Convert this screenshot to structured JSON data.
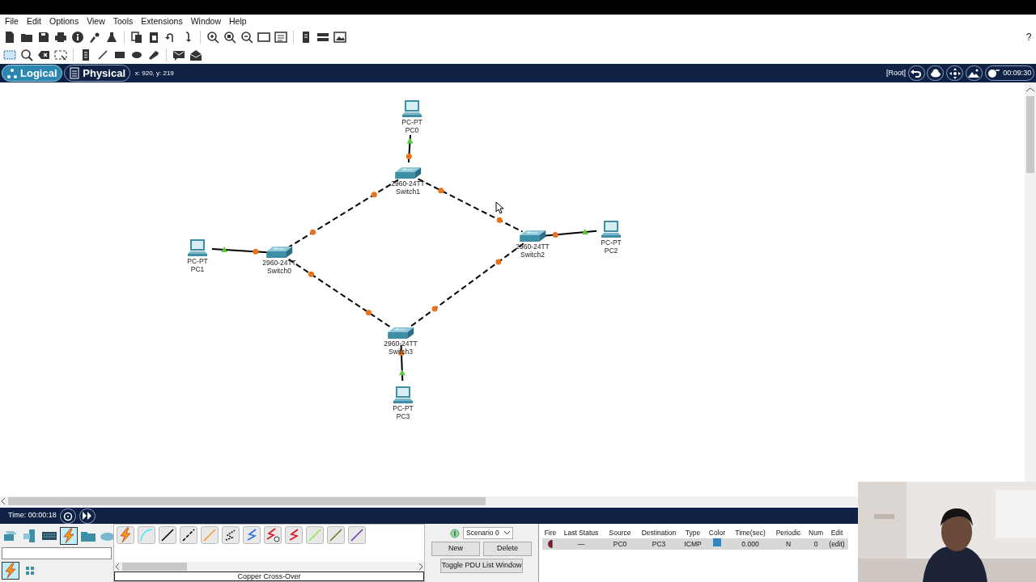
{
  "menu": [
    "File",
    "Edit",
    "Options",
    "View",
    "Tools",
    "Extensions",
    "Window",
    "Help"
  ],
  "help_button": "?",
  "workspace_tabs": [
    {
      "label": "Logical",
      "selected": true
    },
    {
      "label": "Physical",
      "selected": false
    }
  ],
  "cursor_position": "x: 920, y: 219",
  "root_label": "[Root]",
  "clock": "00:09:30",
  "devices": [
    {
      "kind": "pc",
      "model": "PC-PT",
      "name": "PC0"
    },
    {
      "kind": "switch",
      "model": "2960-24TT",
      "name": "Switch1"
    },
    {
      "kind": "switch",
      "model": "2960-24TT",
      "name": "Switch0"
    },
    {
      "kind": "switch",
      "model": "2960-24TT",
      "name": "Switch2"
    },
    {
      "kind": "pc",
      "model": "PC-PT",
      "name": "PC2"
    },
    {
      "kind": "pc",
      "model": "PC-PT",
      "name": "PC1"
    },
    {
      "kind": "switch",
      "model": "2960-24TT",
      "name": "Switch3"
    },
    {
      "kind": "pc",
      "model": "PC-PT",
      "name": "PC3"
    }
  ],
  "links": [
    {
      "kind": "straight",
      "ends": [
        {
          "kind": "triangle",
          "color": "#5cc93b"
        },
        {
          "kind": "circle",
          "color": "#e8731c"
        }
      ]
    },
    {
      "kind": "crossover",
      "ends": [
        {
          "kind": "circle",
          "color": "#e8731c"
        },
        {
          "kind": "circle",
          "color": "#e8731c"
        }
      ]
    },
    {
      "kind": "crossover",
      "ends": [
        {
          "kind": "circle",
          "color": "#e8731c"
        },
        {
          "kind": "circle",
          "color": "#e8731c"
        }
      ]
    },
    {
      "kind": "crossover",
      "ends": [
        {
          "kind": "circle",
          "color": "#e8731c"
        },
        {
          "kind": "circle",
          "color": "#e8731c"
        }
      ]
    },
    {
      "kind": "crossover",
      "ends": [
        {
          "kind": "circle",
          "color": "#e8731c"
        },
        {
          "kind": "circle",
          "color": "#e8731c"
        }
      ]
    },
    {
      "kind": "straight",
      "ends": [
        {
          "kind": "triangle",
          "color": "#5cc93b"
        },
        {
          "kind": "circle",
          "color": "#e8731c"
        }
      ]
    },
    {
      "kind": "straight",
      "ends": [
        {
          "kind": "triangle",
          "color": "#5cc93b"
        },
        {
          "kind": "circle",
          "color": "#e8731c"
        }
      ]
    },
    {
      "kind": "straight",
      "ends": [
        {
          "kind": "triangle",
          "color": "#5cc93b"
        },
        {
          "kind": "circle",
          "color": "#e8731c"
        }
      ]
    }
  ],
  "simulation_time": "Time: 00:00:18",
  "device_categories": [
    {
      "selected": false
    },
    {
      "selected": false
    },
    {
      "selected": false
    },
    {
      "selected": true
    },
    {
      "selected": false
    },
    {
      "selected": false
    }
  ],
  "subcategories": [
    {
      "selected": true
    },
    {
      "selected": false
    }
  ],
  "cable_label": "Copper Cross-Over",
  "scenario": {
    "select": "Scenario 0",
    "buttons": [
      "New",
      "Delete"
    ],
    "toggle": "Toggle PDU List Window"
  },
  "pdu_table": {
    "columns": [
      "Fire",
      "Last Status",
      "Source",
      "Destination",
      "Type",
      "Color",
      "Time(sec)",
      "Periodic",
      "Num",
      "Edit"
    ],
    "rows": [
      {
        "selected": true,
        "last_status": "—",
        "source": "PC0",
        "destination": "PC3",
        "type": "ICMP",
        "color": "#2f86c1",
        "time": "0.000",
        "periodic": "N",
        "num": "0",
        "edit": "(edit)"
      }
    ]
  }
}
